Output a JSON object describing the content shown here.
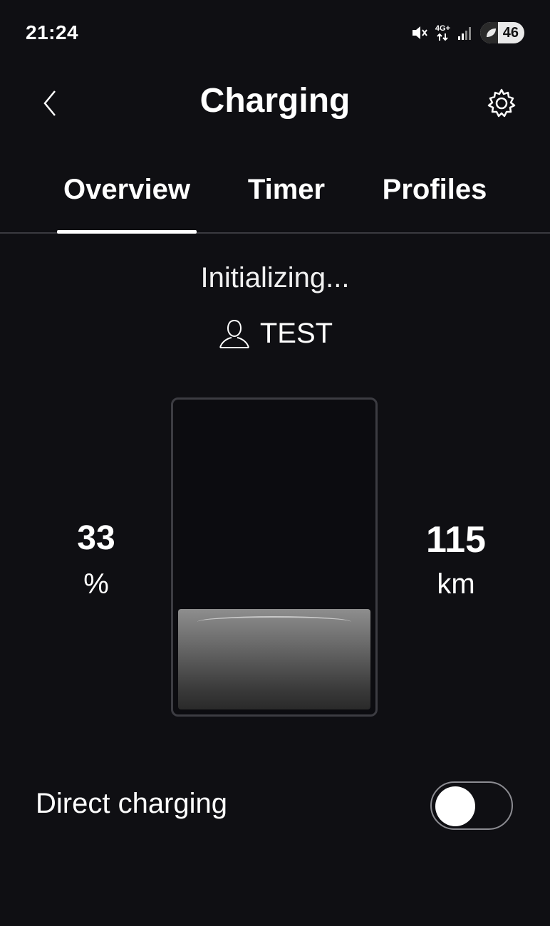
{
  "status_bar": {
    "time": "21:24",
    "network_label": "4G+",
    "battery_level": "46"
  },
  "header": {
    "title": "Charging",
    "back_icon": "chevron-left-icon",
    "settings_icon": "gear-icon"
  },
  "tabs": [
    {
      "label": "Overview",
      "active": true
    },
    {
      "label": "Timer",
      "active": false
    },
    {
      "label": "Profiles",
      "active": false
    }
  ],
  "overview": {
    "status_text": "Initializing...",
    "profile_name": "TEST",
    "profile_icon": "user-icon",
    "state_of_charge": "33",
    "state_of_charge_unit": "%",
    "state_of_charge_fraction": 0.33,
    "range_value": "115",
    "range_unit": "km"
  },
  "direct_charging": {
    "label": "Direct charging",
    "enabled": false
  },
  "colors": {
    "background": "#0f0f13",
    "text": "#ffffff",
    "divider": "#3a3a40"
  }
}
